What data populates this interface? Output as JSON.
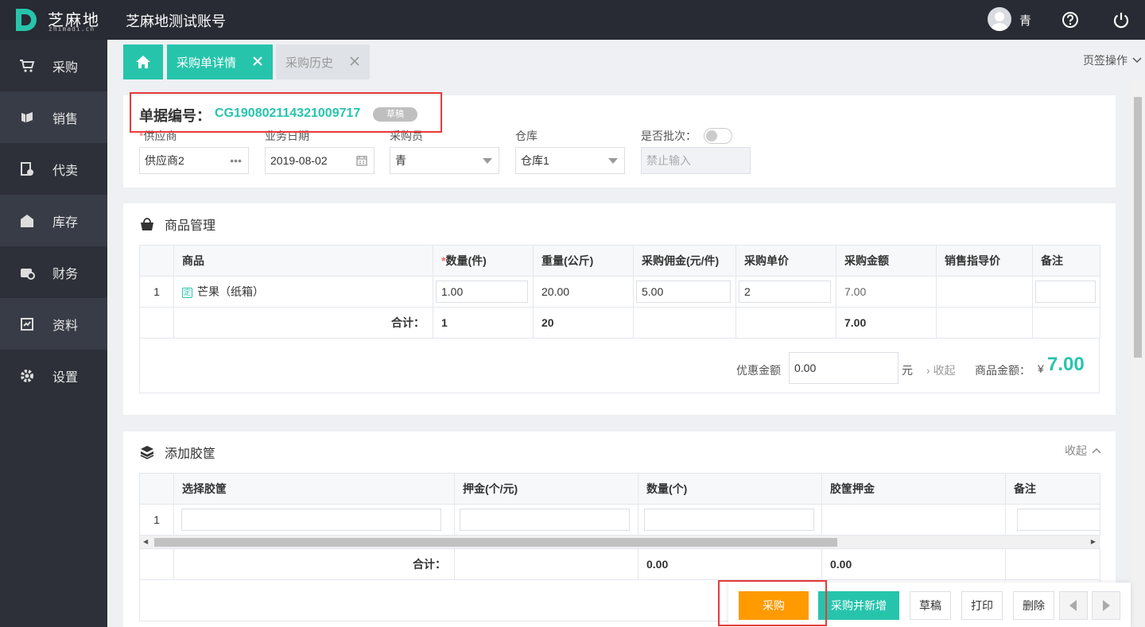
{
  "header": {
    "logo_text": "芝麻地",
    "logo_sub": "zhimadi.cn",
    "account_title": "芝麻地测试账号",
    "user_name": "青"
  },
  "sidebar": {
    "items": [
      {
        "label": "采购",
        "icon": "cart-icon"
      },
      {
        "label": "销售",
        "icon": "sales-icon"
      },
      {
        "label": "代卖",
        "icon": "consign-icon"
      },
      {
        "label": "库存",
        "icon": "warehouse-icon"
      },
      {
        "label": "财务",
        "icon": "finance-icon"
      },
      {
        "label": "资料",
        "icon": "archive-icon"
      },
      {
        "label": "设置",
        "icon": "gear-icon"
      }
    ]
  },
  "tabs": {
    "items": [
      {
        "label": "采购单详情",
        "active": true
      },
      {
        "label": "采购历史",
        "active": false
      }
    ],
    "ops_label": "页签操作"
  },
  "doc": {
    "number_label": "单据编号：",
    "number": "CG190802114321009717",
    "status": "草稿",
    "fields": {
      "supplier_label": "供应商",
      "supplier_value": "供应商2",
      "date_label": "业务日期",
      "date_value": "2019-08-02",
      "buyer_label": "采购员",
      "buyer_value": "青",
      "warehouse_label": "仓库",
      "warehouse_value": "仓库1",
      "batch_label": "是否批次：",
      "batch_placeholder": "禁止输入"
    }
  },
  "goods": {
    "title": "商品管理",
    "columns": [
      "",
      "商品",
      "数量(件)",
      "重量(公斤)",
      "采购佣金(元/件)",
      "采购单价",
      "采购金额",
      "销售指导价",
      "备注"
    ],
    "row": {
      "index": "1",
      "tag": "定",
      "name": "芒果（纸箱）",
      "qty": "1.00",
      "weight": "20.00",
      "commission": "5.00",
      "unit_price": "2",
      "amount": "7.00",
      "guide_price": "",
      "remark": ""
    },
    "total": {
      "label": "合计：",
      "qty": "1",
      "weight": "20",
      "amount": "7.00"
    },
    "discount_label": "优惠金额",
    "discount_value": "0.00",
    "discount_unit": "元",
    "collapse_label": "收起",
    "goods_amount_label": "商品金额：",
    "currency": "¥",
    "goods_amount": "7.00"
  },
  "baskets": {
    "title": "添加胶筐",
    "collapse_label": "收起",
    "columns": [
      "",
      "选择胶筐",
      "押金(个/元)",
      "数量(个)",
      "胶筐押金",
      "备注"
    ],
    "row_index": "1",
    "total": {
      "label": "合计：",
      "qty": "0.00",
      "deposit": "0.00"
    }
  },
  "actions": {
    "purchase": "采购",
    "purchase_new": "采购并新增",
    "draft": "草稿",
    "print": "打印",
    "delete": "删除"
  },
  "colors": {
    "accent": "#27c4ac",
    "topbar": "#282b33",
    "sidebar": "#2d3039",
    "orange": "#ff9a00",
    "highlight": "#e83a3a"
  }
}
